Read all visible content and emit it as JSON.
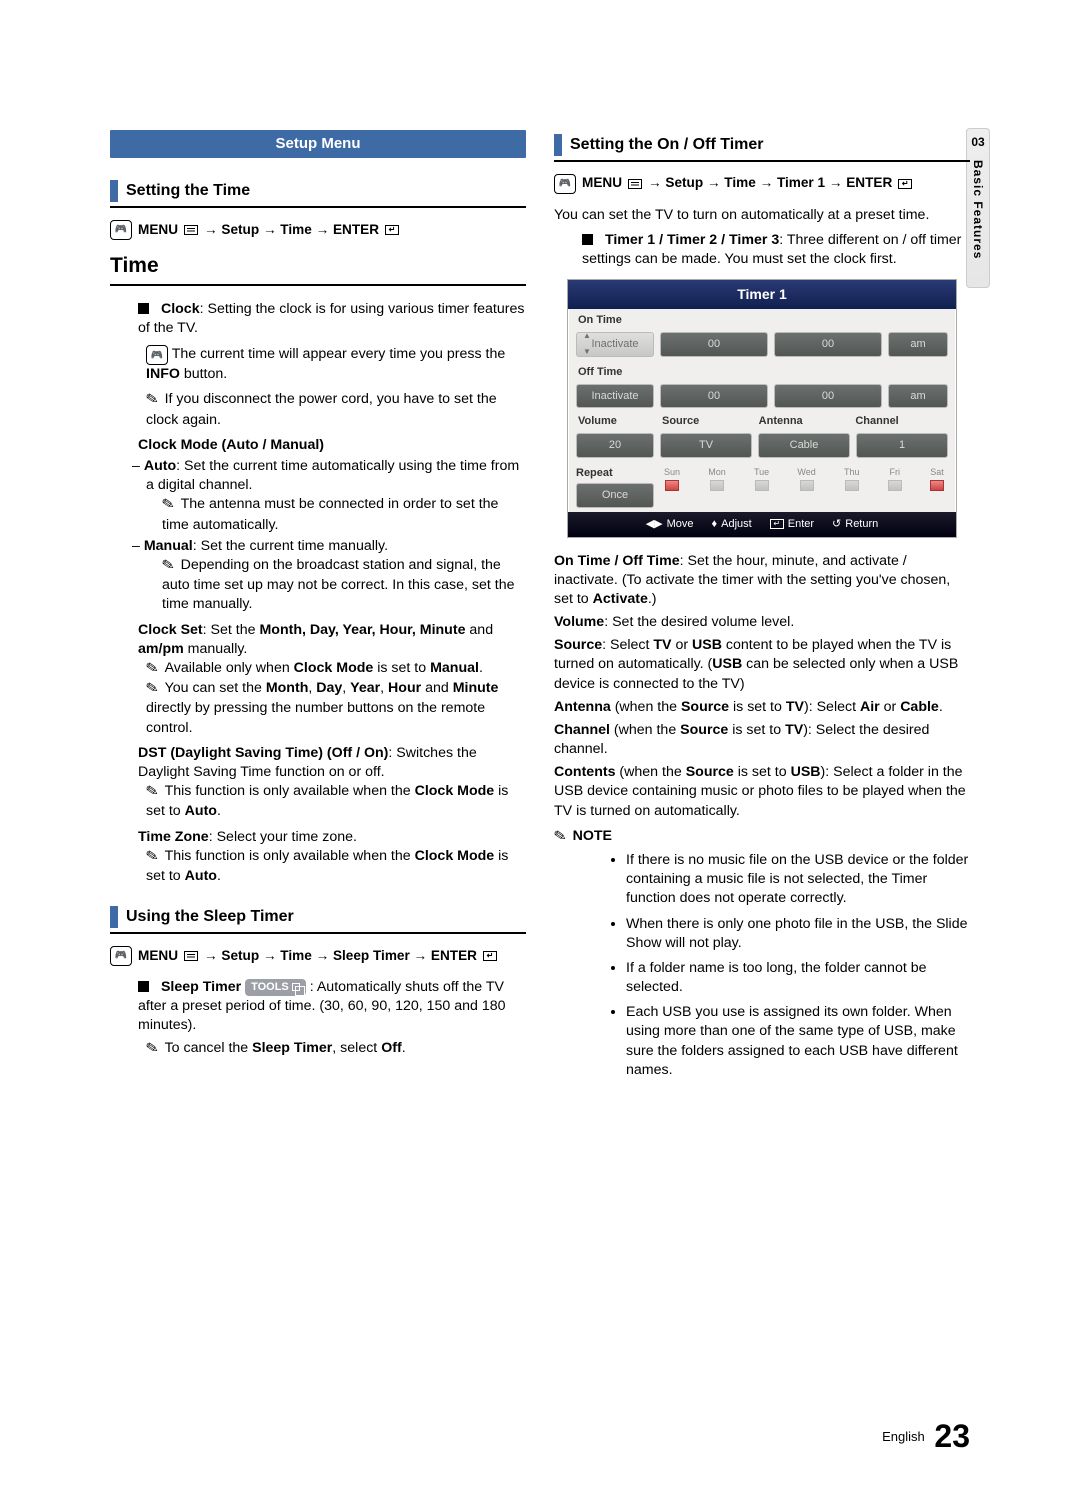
{
  "side_tab": {
    "num": "03",
    "label": "Basic Features"
  },
  "left": {
    "setup_menu": "Setup Menu",
    "setting_time": "Setting the Time",
    "menu_line_time": {
      "menu": "MENU",
      "path": " → Setup → Time → ENTER"
    },
    "time_heading": "Time",
    "clock_intro_b": "Clock",
    "clock_intro": ": Setting the clock is for using various timer features of the TV.",
    "info_note": "The current time will appear every time you press the ",
    "info_btn": "INFO",
    "info_note_end": " button.",
    "disconnect_note": "If you disconnect the power cord, you have to set the clock again.",
    "clock_mode_b": "Clock Mode (Auto / Manual)",
    "auto_b": "Auto",
    "auto_txt": ": Set the current time automatically using the time from a digital channel.",
    "auto_note": "The antenna must be connected in order to set the time automatically.",
    "manual_b": "Manual",
    "manual_txt": ": Set the current time manually.",
    "manual_note": "Depending on the broadcast station and signal, the auto time set up may not be correct. In this case, set the time manually.",
    "clock_set_b": "Clock Set",
    "clock_set_txt1": ": Set the ",
    "clock_set_txt_b": "Month, Day, Year, Hour, Minute",
    "clock_set_txt2": " and ",
    "clock_set_txt_b2": "am/pm",
    "clock_set_txt3": " manually.",
    "clock_set_note1_a": "Available only when ",
    "clock_set_note1_b": "Clock Mode",
    "clock_set_note1_c": " is set to ",
    "clock_set_note1_d": "Manual",
    "clock_set_note2_a": "You can set the ",
    "clock_set_note2_b": "Month",
    "clock_set_note2_c": "Day",
    "clock_set_note2_d": "Year",
    "clock_set_note2_e": "Hour",
    "clock_set_note2_f": "Minute",
    "clock_set_note2_g": " directly by pressing the number buttons on the remote control.",
    "dst_b": "DST (Daylight Saving Time) (Off / On)",
    "dst_txt": ": Switches the Daylight Saving Time function on or off.",
    "dst_note_a": "This function is only available when the ",
    "dst_note_b": "Clock Mode",
    "dst_note_c": " is set to ",
    "dst_note_d": "Auto",
    "tz_b": "Time Zone",
    "tz_txt": ": Select your time zone.",
    "tz_note_a": "This function is only available when the ",
    "tz_note_b": "Clock Mode",
    "tz_note_c": " is set to ",
    "tz_note_d": "Auto",
    "sleep_heading": "Using the Sleep Timer",
    "sleep_menu": {
      "menu": "MENU",
      "path": " → Setup → Time → Sleep Timer → ENTER"
    },
    "sleep_b": "Sleep Timer",
    "tools_label": "TOOLS",
    "sleep_txt": " : Automatically shuts off the TV after a preset period of time. (30, 60, 90, 120, 150 and 180 minutes).",
    "sleep_note_a": "To cancel the ",
    "sleep_note_b": "Sleep Timer",
    "sleep_note_c": ", select ",
    "sleep_note_d": "Off"
  },
  "right": {
    "onoff_heading": "Setting the On / Off Timer",
    "menu_line": {
      "menu": "MENU",
      "path": " → Setup → Time → Timer 1 → ENTER"
    },
    "preset_intro": "You can set the TV to turn on automatically at a preset time.",
    "timers_b": "Timer 1 / Timer 2 / Timer 3",
    "timers_txt": ": Three different on / off timer settings can be made. You must set the clock first.",
    "osd": {
      "title": "Timer 1",
      "on_time": "On Time",
      "off_time": "Off Time",
      "inactivate": "Inactivate",
      "zero": "00",
      "am": "am",
      "volume": "Volume",
      "source": "Source",
      "antenna": "Antenna",
      "channel": "Channel",
      "vol_val": "20",
      "src_val": "TV",
      "ant_val": "Cable",
      "ch_val": "1",
      "repeat": "Repeat",
      "once": "Once",
      "days": [
        "Sun",
        "Mon",
        "Tue",
        "Wed",
        "Thu",
        "Fri",
        "Sat"
      ],
      "footer": {
        "move": "Move",
        "adjust": "Adjust",
        "enter": "Enter",
        "return": "Return"
      }
    },
    "onoff_b": "On Time / Off Time",
    "onoff_txt1": ": Set the hour, minute, and activate / inactivate. (To activate the timer with the setting you've chosen, set to ",
    "activate_b": "Activate",
    "onoff_txt2": ".)",
    "vol_b": "Volume",
    "vol_txt": ": Set the desired volume level.",
    "src_b": "Source",
    "src_txt1": ": Select ",
    "src_txt_tv": "TV",
    "src_txt_or": " or ",
    "src_txt_usb": "USB",
    "src_txt2": " content to be played when the TV is turned on automatically. (",
    "src_txt3": " can be selected only when a USB device is connected to the TV)",
    "ant_b": "Antenna",
    "ant_txt1": " (when the ",
    "ant_txt_src": "Source",
    "ant_txt2": " is set to ",
    "ant_txt_tv": "TV",
    "ant_txt3": "): Select ",
    "ant_txt_air": "Air",
    "ant_txt4": " or ",
    "ant_txt_cable": "Cable",
    "ch_b": "Channel",
    "ch_txt1": " (when the ",
    "ch_txt2": " is set to ",
    "ch_txt3": "): Select the desired channel.",
    "cont_b": "Contents",
    "cont_txt1": " (when the ",
    "cont_txt2": " is set to ",
    "cont_txt_usb": "USB",
    "cont_txt3": "): Select a folder in the USB device containing music or photo files to be played when the TV is turned on automatically.",
    "note_label": "NOTE",
    "notes": [
      "If there is no music file on the USB device or the folder containing a music file is not selected, the Timer function does not operate correctly.",
      "When there is only one photo file in the USB, the Slide Show will not play.",
      "If a folder name is too long, the folder cannot be selected.",
      "Each USB you use is assigned its own folder. When using more than one of the same type of USB, make sure the folders assigned to each USB have different names."
    ]
  },
  "footer": {
    "lang": "English",
    "page": "23"
  }
}
